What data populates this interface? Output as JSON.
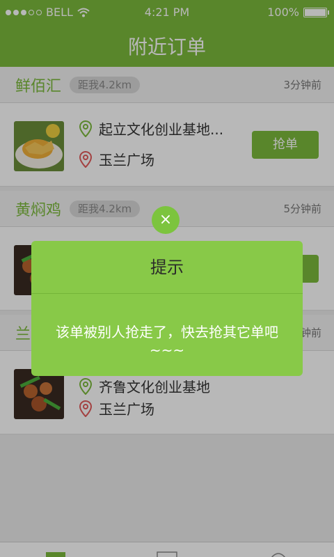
{
  "status_bar": {
    "carrier": "BELL",
    "time": "4:21 PM",
    "battery": "100%"
  },
  "nav": {
    "title": "附近订单"
  },
  "orders": [
    {
      "shop": "鲜佰汇",
      "distance": "距我4.2km",
      "time_ago": "3分钟前",
      "pickup": "起立文化创业基地...",
      "dropoff": "玉兰广场",
      "button": "抢单",
      "image": "food-photo"
    },
    {
      "shop": "黄焖鸡",
      "distance": "距我4.2km",
      "time_ago": "5分钟前",
      "image": "food-photo"
    },
    {
      "shop": "兰",
      "time_ago": "分钟前",
      "pickup": "齐鲁文化创业基地",
      "dropoff": "玉兰广场",
      "image": "food-photo"
    }
  ],
  "dialog": {
    "close_icon": "×",
    "title": "提示",
    "message": "该单被别人抢走了，快去抢其它单吧~~~"
  },
  "colors": {
    "brand_green": "#7cba3c",
    "dialog_green": "#88c948",
    "pickup_pin": "#7cba3c",
    "dropoff_pin": "#e25b5b"
  }
}
